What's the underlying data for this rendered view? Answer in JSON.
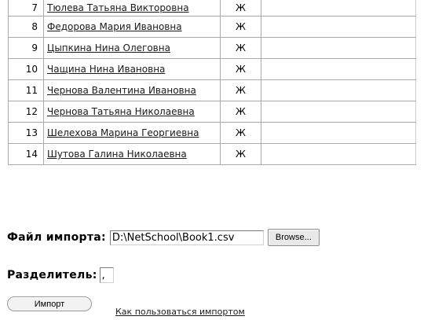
{
  "table": {
    "rows": [
      {
        "num": "7",
        "name": "Тюлева Татьяна Викторовна",
        "sex": "Ж"
      },
      {
        "num": "8",
        "name": "Федорова Мария Ивановна",
        "sex": "Ж"
      },
      {
        "num": "9",
        "name": "Цыпкина Нина Олеговна",
        "sex": "Ж"
      },
      {
        "num": "10",
        "name": "Чащина Нина Ивановна",
        "sex": "Ж"
      },
      {
        "num": "11",
        "name": "Чернова Валентина Ивановна",
        "sex": "Ж"
      },
      {
        "num": "12",
        "name": "Чернова Татьяна Николаевна",
        "sex": "Ж"
      },
      {
        "num": "13",
        "name": "Шелехова Марина Георгиевна",
        "sex": "Ж"
      },
      {
        "num": "14",
        "name": "Шутова Галина Николаевна",
        "sex": "Ж"
      }
    ]
  },
  "import_form": {
    "file_label": "Файл импорта:",
    "file_value": "D:\\NetSchool\\Book1.csv",
    "browse_label": "Browse...",
    "separator_label": "Разделитель:",
    "separator_value": ",",
    "import_button": "Импорт",
    "help_link": "Как пользоваться импортом"
  }
}
